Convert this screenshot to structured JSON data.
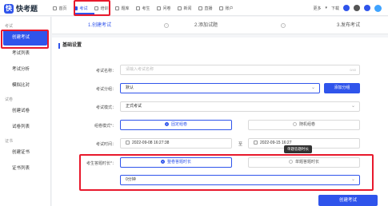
{
  "brand": {
    "logo_glyph": "快",
    "name": "快考题"
  },
  "nav": {
    "items": [
      {
        "label": "首页"
      },
      {
        "label": "考试"
      },
      {
        "label": "培训"
      },
      {
        "label": "题库"
      },
      {
        "label": "考生"
      },
      {
        "label": "问卷"
      },
      {
        "label": "新闻"
      },
      {
        "label": "直播"
      },
      {
        "label": "账户"
      }
    ],
    "active_index": 1,
    "right": {
      "menu": "更多",
      "download": "下载"
    }
  },
  "sidebar": {
    "groups": [
      {
        "label": "考试",
        "items": [
          "创建考试",
          "考试列表",
          "考试分析",
          "模拟比对"
        ]
      },
      {
        "label": "试卷",
        "items": [
          "创建试卷",
          "试卷列表"
        ]
      },
      {
        "label": "证书",
        "items": [
          "创建证书",
          "证书列表"
        ]
      }
    ],
    "active": "创建考试"
  },
  "steps": [
    "1.创建考试",
    "2.添加试题",
    "3.发布考试"
  ],
  "form": {
    "section_title": "基础设置",
    "name": {
      "label": "考试名称",
      "placeholder": "请输入考试名称",
      "counter": "0/40"
    },
    "category": {
      "label": "考试分组",
      "value": "默认",
      "add_button": "添加分组"
    },
    "mode": {
      "label": "考试模式",
      "value": "正式考试"
    },
    "paper_mode": {
      "label": "组卷模式",
      "options": [
        "固定组卷",
        "随机组卷"
      ],
      "selected": 0
    },
    "time": {
      "label": "考试时间",
      "start": "2022-09-08 16:27:38",
      "separator": "至",
      "end": "2022-09-15 16:27"
    },
    "question_time": {
      "label": "考生答题时长",
      "options": [
        "整卷答题时长",
        "单题答题时长"
      ],
      "selected": 0,
      "tooltip": "单题答题时长",
      "duration": "0分钟"
    }
  },
  "footer": {
    "create_button": "创建考试"
  },
  "colors": {
    "accent": "#2f54eb",
    "highlight": "#e8192c"
  }
}
